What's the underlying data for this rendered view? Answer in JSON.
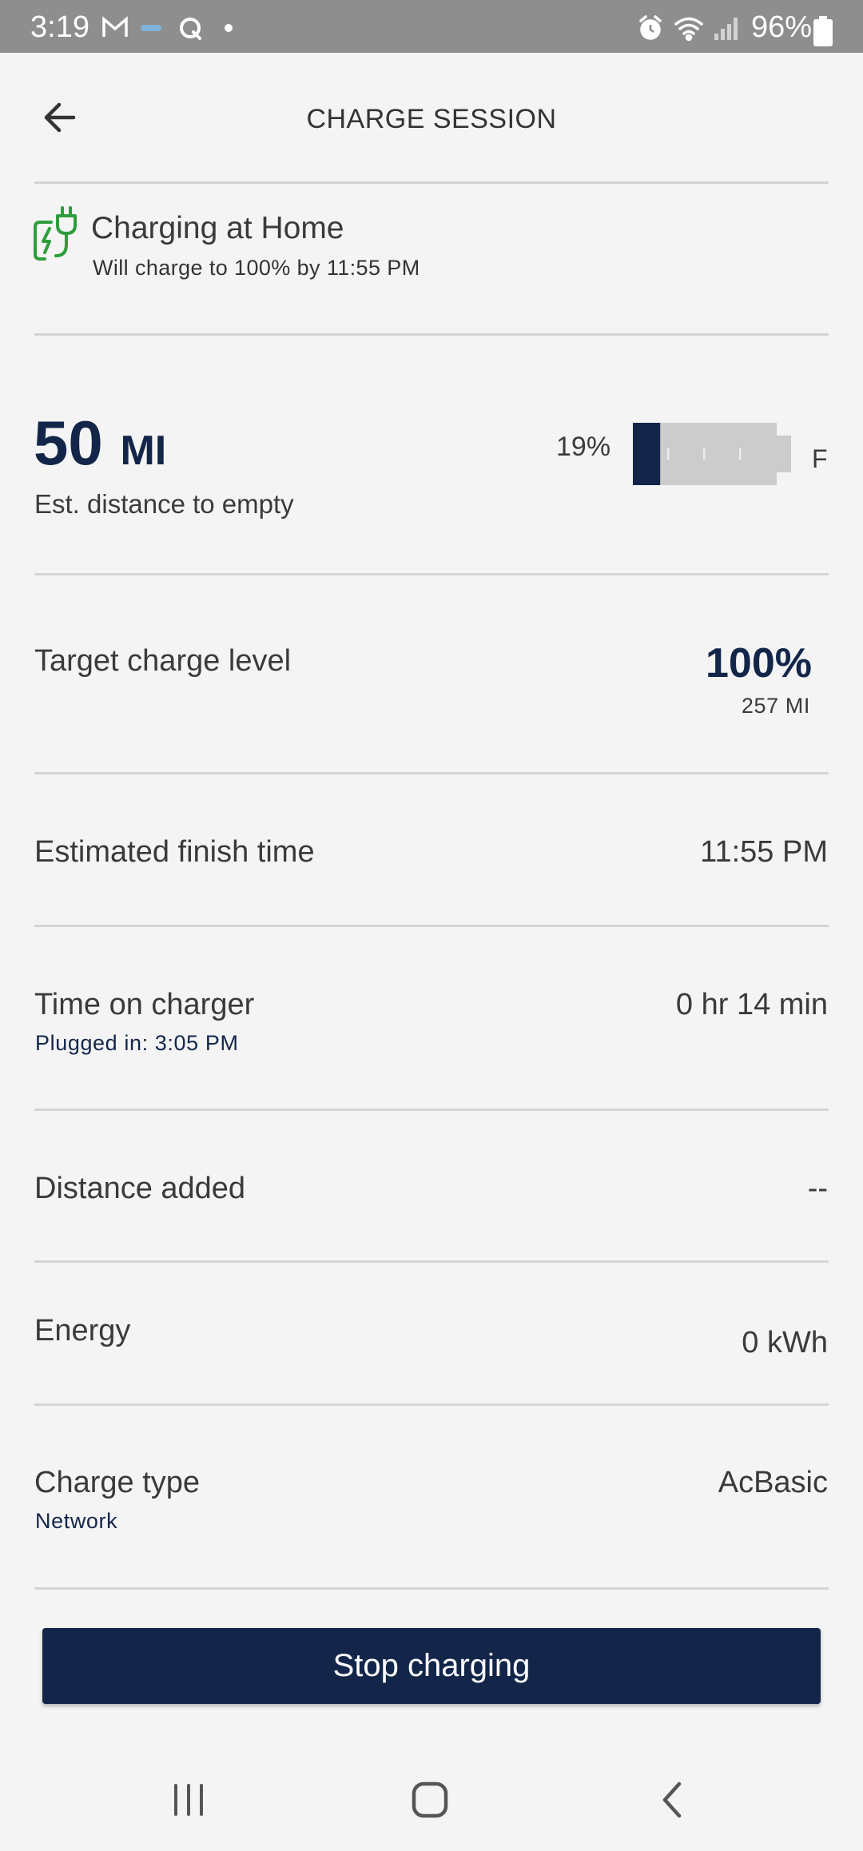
{
  "status_bar": {
    "time": "3:19",
    "battery": "96%",
    "icons": [
      "gmail-icon",
      "link-icon",
      "quora-icon",
      "dot-icon",
      "alarm-icon",
      "wifi-icon",
      "signal-icon",
      "battery-icon"
    ]
  },
  "header": {
    "title": "CHARGE SESSION",
    "back_icon": "arrow-left-icon"
  },
  "charging": {
    "icon": "plug-charging-icon",
    "icon_color": "#2e9e3c",
    "title": "Charging at Home",
    "subtitle": "Will charge to 100% by 11:55 PM"
  },
  "range": {
    "value": "50",
    "unit": "MI",
    "label": "Est. distance to empty",
    "battery_percent": "19%",
    "battery_level": 0.19,
    "full_label": "F"
  },
  "rows": {
    "target": {
      "label": "Target charge level",
      "value": "100%",
      "sub": "257 MI"
    },
    "finish": {
      "label": "Estimated finish time",
      "value": "11:55 PM"
    },
    "time_on_charger": {
      "label": "Time on charger",
      "sub": "Plugged in: 3:05 PM",
      "value": "0 hr 14 min"
    },
    "distance": {
      "label": "Distance added",
      "value": "--"
    },
    "energy": {
      "label": "Energy",
      "value": "0 kWh"
    },
    "charge_type": {
      "label": "Charge type",
      "sub": "Network",
      "value": "AcBasic"
    }
  },
  "actions": {
    "stop_label": "Stop charging"
  },
  "colors": {
    "brand_navy": "#13264a",
    "background": "#f4f4f4",
    "divider": "#d4d4d4",
    "status_bar": "#8e8e8e"
  }
}
